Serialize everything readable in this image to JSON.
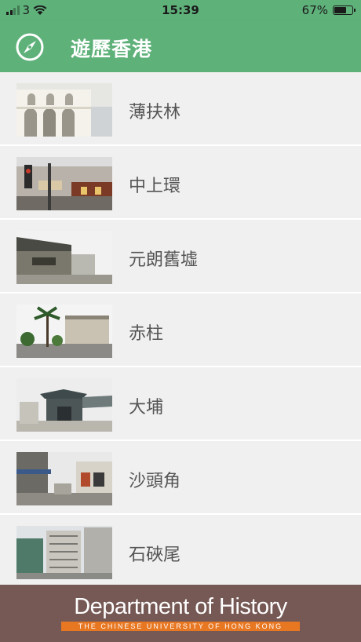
{
  "status_bar": {
    "carrier": "3",
    "time": "15:39",
    "battery": "67%"
  },
  "header": {
    "title": "遊歷香港",
    "icon": "compass-icon"
  },
  "places": [
    {
      "name": "薄扶林",
      "icon": "photo-arched-building"
    },
    {
      "name": "中上環",
      "icon": "photo-street-signboards"
    },
    {
      "name": "元朗舊墟",
      "icon": "photo-old-temple"
    },
    {
      "name": "赤柱",
      "icon": "photo-colonial-building-palms"
    },
    {
      "name": "大埔",
      "icon": "photo-chinese-pavilion"
    },
    {
      "name": "沙頭角",
      "icon": "photo-street-shops"
    },
    {
      "name": "石硤尾",
      "icon": "photo-public-estate"
    }
  ],
  "footer": {
    "title": "Department of History",
    "subtitle": "THE CHINESE UNIVERSITY OF HONG KONG",
    "colors": {
      "background": "#765955",
      "accent": "#e87722"
    }
  },
  "colors": {
    "header": "#5fb17a",
    "list_background": "#f0f0f0"
  }
}
